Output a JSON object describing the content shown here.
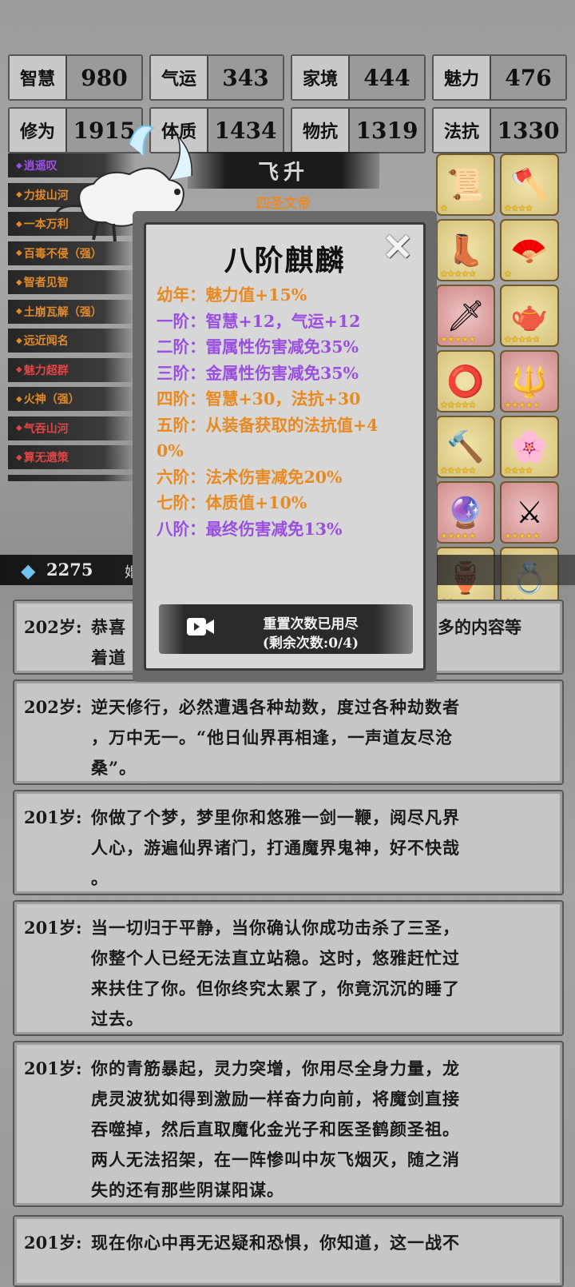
{
  "stats": [
    {
      "label": "智慧",
      "value": "980"
    },
    {
      "label": "气运",
      "value": "343"
    },
    {
      "label": "家境",
      "value": "444"
    },
    {
      "label": "魅力",
      "value": "476"
    },
    {
      "label": "修为",
      "value": "1915"
    },
    {
      "label": "体质",
      "value": "1434"
    },
    {
      "label": "物抗",
      "value": "1319"
    },
    {
      "label": "法抗",
      "value": "1330"
    }
  ],
  "traits": [
    {
      "label": "逍遥叹",
      "color": "purple"
    },
    {
      "label": "力拔山河",
      "color": "orange"
    },
    {
      "label": "一本万利",
      "color": "orange"
    },
    {
      "label": "百毒不侵（强）",
      "color": "orange"
    },
    {
      "label": "智者见智",
      "color": "orange"
    },
    {
      "label": "土崩瓦解（强）",
      "color": "orange"
    },
    {
      "label": "远近闻名",
      "color": "orange"
    },
    {
      "label": "魅力超群",
      "color": "red"
    },
    {
      "label": "火神（强）",
      "color": "orange"
    },
    {
      "label": "气吞山河",
      "color": "red"
    },
    {
      "label": "算无遗策",
      "color": "red"
    },
    {
      "label": "",
      "color": "red"
    }
  ],
  "header": {
    "title": "飞升",
    "subtitle": "四圣文帝"
  },
  "equipment": [
    {
      "icon": "scroll-icon",
      "glyph": "📜",
      "bg": "gold",
      "stars": "★"
    },
    {
      "icon": "axe-icon",
      "glyph": "🪓",
      "bg": "gold",
      "stars": "★★★★"
    },
    {
      "icon": "boots-icon",
      "glyph": "👢",
      "bg": "gold",
      "stars": "★★★★★"
    },
    {
      "icon": "fan-icon",
      "glyph": "🪭",
      "bg": "gold",
      "stars": "★"
    },
    {
      "icon": "sword-icon",
      "glyph": "🗡",
      "bg": "pink",
      "stars": "★★★★★"
    },
    {
      "icon": "teapot-icon",
      "glyph": "🫖",
      "bg": "gold",
      "stars": "★★★★★"
    },
    {
      "icon": "bracelet-icon",
      "glyph": "⭕",
      "bg": "gold",
      "stars": "★★★★★"
    },
    {
      "icon": "spear-icon",
      "glyph": "🔱",
      "bg": "pink",
      "stars": "★★★★★"
    },
    {
      "icon": "mace-icon",
      "glyph": "🔨",
      "bg": "gold",
      "stars": "★★★★★"
    },
    {
      "icon": "hairpin-icon",
      "glyph": "🌸",
      "bg": "gold",
      "stars": "★★★★"
    },
    {
      "icon": "mirror-icon",
      "glyph": "🔮",
      "bg": "pink",
      "stars": "★★★★★"
    },
    {
      "icon": "halberd-icon",
      "glyph": "⚔",
      "bg": "pink",
      "stars": "★★★★★"
    },
    {
      "icon": "cauldron-icon",
      "glyph": "🏺",
      "bg": "gold",
      "stars": "★★"
    },
    {
      "icon": "ring-icon",
      "glyph": "💍",
      "bg": "gold",
      "stars": "★★★"
    }
  ],
  "currency": {
    "value": "2275",
    "trailing": "婚"
  },
  "modal": {
    "title": "八阶麒麟",
    "levels": [
      {
        "text": "幼年：魅力值+15%",
        "color": "o"
      },
      {
        "text": "一阶：智慧+12，气运+12",
        "color": "p"
      },
      {
        "text": "二阶：雷属性伤害减免35%",
        "color": "p"
      },
      {
        "text": "三阶：金属性伤害减免35%",
        "color": "p"
      },
      {
        "text": "四阶：智慧+30，法抗+30",
        "color": "o"
      },
      {
        "text": "五阶：从装备获取的法抗值+4",
        "color": "o"
      },
      {
        "text": "0%",
        "color": "o"
      },
      {
        "text": "六阶：法术伤害减免20%",
        "color": "o"
      },
      {
        "text": "七阶：体质值+10%",
        "color": "o"
      },
      {
        "text": "八阶：最终伤害减免13%",
        "color": "p"
      }
    ],
    "button_line1": "重置次数已用尽",
    "button_line2": "(剩余次数:0/4)"
  },
  "entries": [
    {
      "age": "202岁:",
      "lines": [
        "恭喜",
        "着道"
      ],
      "tail": "多的内容等"
    },
    {
      "age": "202岁:",
      "lines": [
        "逆天修行，必然遭遇各种劫数，度过各种劫数者",
        "，万中无一。“他日仙界再相逢，一声道友尽沧",
        "桑”。"
      ]
    },
    {
      "age": "201岁:",
      "lines": [
        "你做了个梦，梦里你和悠雅一剑一鞭，阅尽凡界",
        "人心，游遍仙界诸门，打通魔界鬼神，好不快哉",
        "。"
      ]
    },
    {
      "age": "201岁:",
      "lines": [
        "当一切归于平静，当你确认你成功击杀了三圣，",
        "你整个人已经无法直立站稳。这时，悠雅赶忙过",
        "来扶住了你。但你终究太累了，你竟沉沉的睡了",
        "过去。"
      ]
    },
    {
      "age": "201岁:",
      "lines": [
        "你的青筋暴起，灵力突增，你用尽全身力量，龙",
        "虎灵波犹如得到激励一样奋力向前，将魔剑直接",
        "吞噬掉，然后直取魔化金光子和医圣鹤颜圣祖。",
        "两人无法招架，在一阵惨叫中灰飞烟灭，随之消",
        "失的还有那些阴谋阳谋。"
      ]
    },
    {
      "age": "201岁:",
      "lines": [
        "现在你心中再无迟疑和恐惧，你知道，这一战不"
      ]
    }
  ]
}
